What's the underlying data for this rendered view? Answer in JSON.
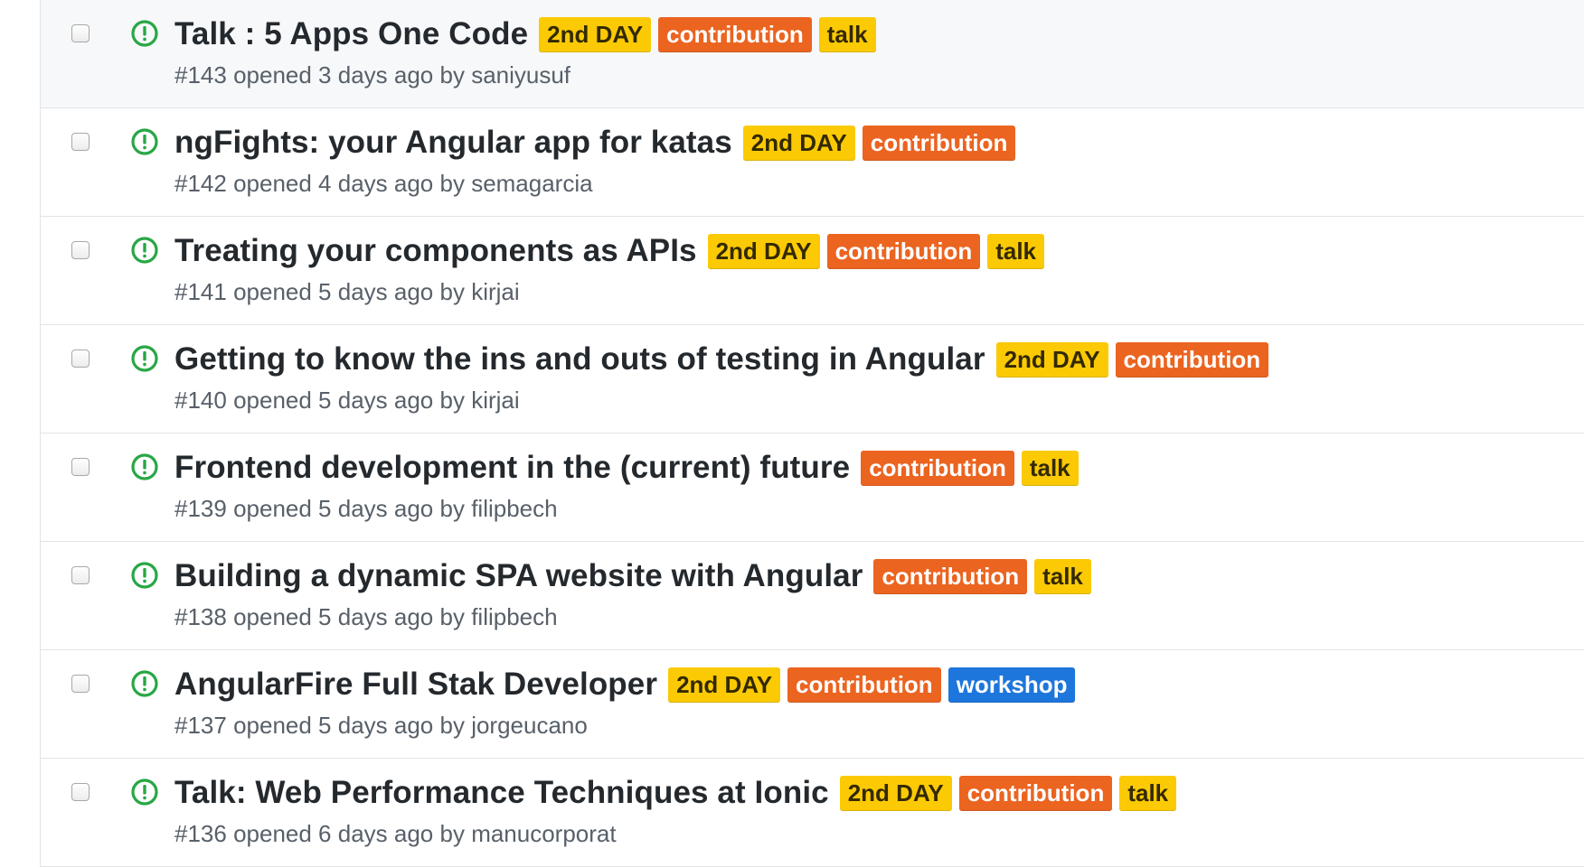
{
  "colors": {
    "open_icon": "#28a745",
    "label_2nd_day": "#fbca04",
    "label_contribution": "#eb6420",
    "label_talk": "#fbca04",
    "label_workshop": "#1d76db",
    "meta_text": "#586069",
    "title_text": "#24292e"
  },
  "issues": [
    {
      "title": "Talk : 5 Apps One Code",
      "labels": [
        "2nd DAY",
        "contribution",
        "talk"
      ],
      "number": "#143",
      "opened": "opened 3 days ago by",
      "author": "saniyusuf"
    },
    {
      "title": "ngFights: your Angular app for katas",
      "labels": [
        "2nd DAY",
        "contribution"
      ],
      "number": "#142",
      "opened": "opened 4 days ago by",
      "author": "semagarcia"
    },
    {
      "title": "Treating your components as APIs",
      "labels": [
        "2nd DAY",
        "contribution",
        "talk"
      ],
      "number": "#141",
      "opened": "opened 5 days ago by",
      "author": "kirjai"
    },
    {
      "title": "Getting to know the ins and outs of testing in Angular",
      "labels": [
        "2nd DAY",
        "contribution"
      ],
      "number": "#140",
      "opened": "opened 5 days ago by",
      "author": "kirjai"
    },
    {
      "title": "Frontend development in the (current) future",
      "labels": [
        "contribution",
        "talk"
      ],
      "number": "#139",
      "opened": "opened 5 days ago by",
      "author": "filipbech"
    },
    {
      "title": "Building a dynamic SPA website with Angular",
      "labels": [
        "contribution",
        "talk"
      ],
      "number": "#138",
      "opened": "opened 5 days ago by",
      "author": "filipbech"
    },
    {
      "title": "AngularFire Full Stak Developer",
      "labels": [
        "2nd DAY",
        "contribution",
        "workshop"
      ],
      "number": "#137",
      "opened": "opened 5 days ago by",
      "author": "jorgeucano"
    },
    {
      "title": "Talk: Web Performance Techniques at Ionic",
      "labels": [
        "2nd DAY",
        "contribution",
        "talk"
      ],
      "number": "#136",
      "opened": "opened 6 days ago by",
      "author": "manucorporat"
    }
  ]
}
